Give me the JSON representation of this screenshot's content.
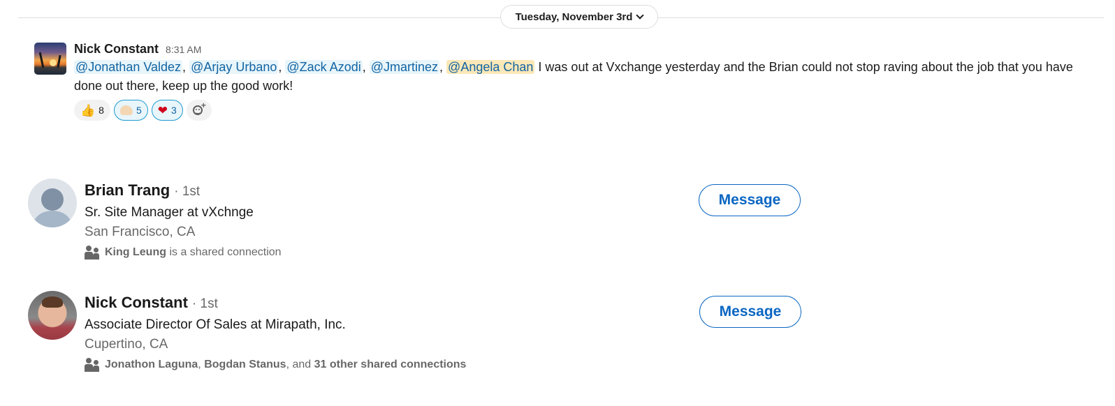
{
  "date_divider": {
    "label": "Tuesday, November 3rd"
  },
  "message": {
    "author": "Nick Constant",
    "time": "8:31 AM",
    "mentions": [
      "@Jonathan Valdez",
      "@Arjay Urbano",
      "@Zack Azodi",
      "@Jmartinez",
      "@Angela Chan"
    ],
    "text": "I was out at Vxchange yesterday and the Brian could not stop raving about the job that you have done out there, keep up the good work!",
    "reactions": [
      {
        "emoji": "thumbs-up",
        "glyph": "👍",
        "count": "8",
        "active": false
      },
      {
        "emoji": "flexed-biceps",
        "glyph": "💪",
        "count": "5",
        "active": true
      },
      {
        "emoji": "red-heart",
        "glyph": "❤",
        "count": "3",
        "active": true
      }
    ]
  },
  "connections": [
    {
      "name": "Brian Trang",
      "degree": "· 1st",
      "title": "Sr. Site Manager at vXchnge",
      "location": "San Francisco, CA",
      "shared_names": [
        "King Leung"
      ],
      "shared_suffix": "is a shared connection",
      "button_label": "Message"
    },
    {
      "name": "Nick Constant",
      "degree": "· 1st",
      "title": "Associate Director Of Sales at Mirapath, Inc.",
      "location": "Cupertino, CA",
      "shared_names": [
        "Jonathon Laguna",
        "Bogdan Stanus"
      ],
      "shared_and": ", and",
      "shared_other": "31 other shared connections",
      "button_label": "Message"
    }
  ],
  "colors": {
    "link": "#1264a3",
    "self_mention_bg": "#fbe8b8",
    "linkedin_blue": "#0a66c2"
  }
}
